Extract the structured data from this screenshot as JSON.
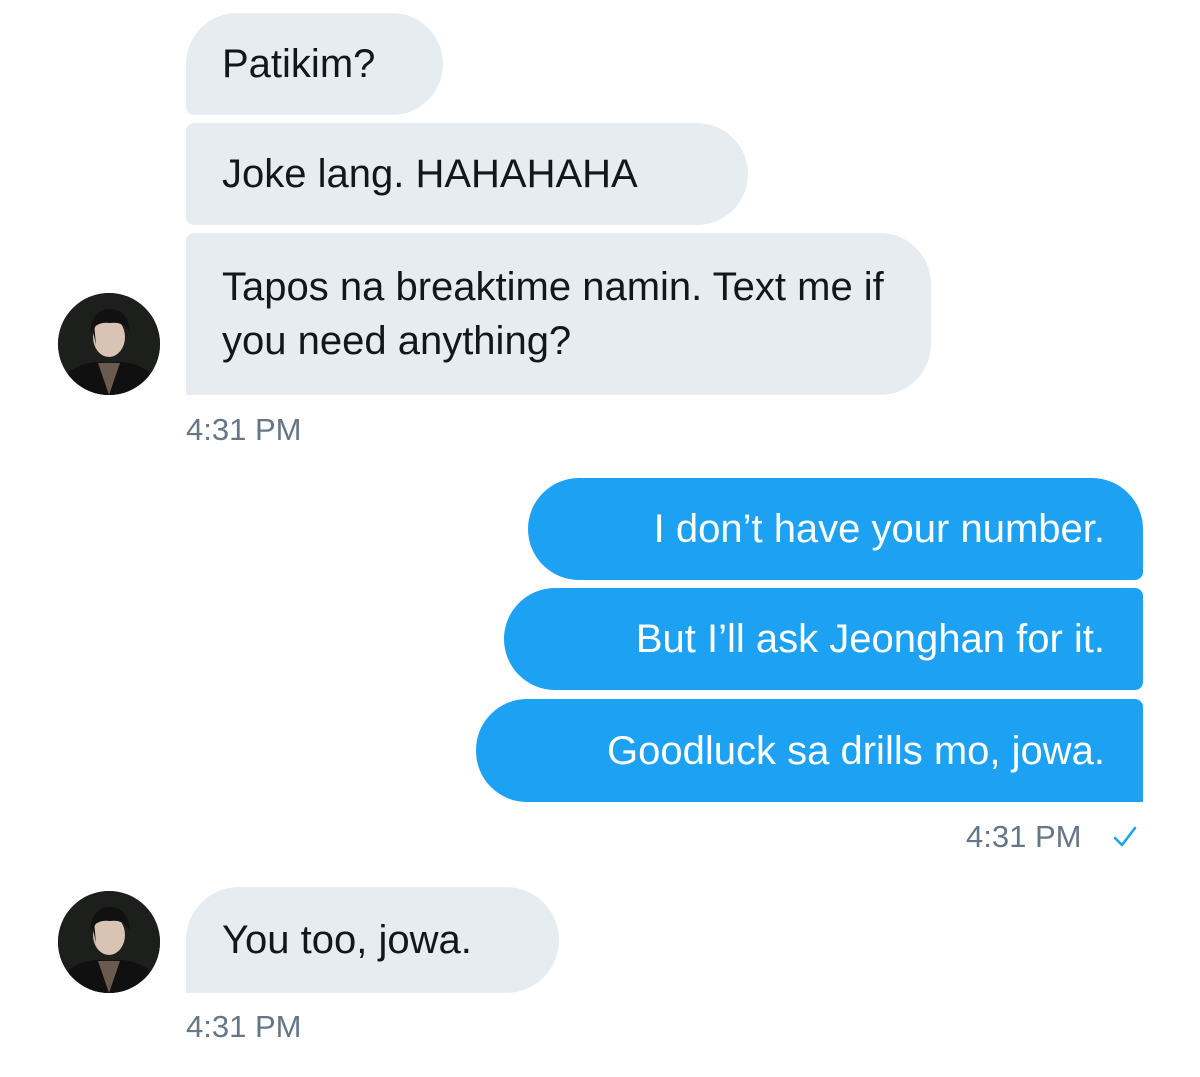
{
  "conversation": {
    "messages": [
      {
        "sender": "them",
        "text": "Patikim?"
      },
      {
        "sender": "them",
        "text": "Joke lang. HAHAHAHA"
      },
      {
        "sender": "them",
        "text": "Tapos na breaktime namin. Text me if you need anything?"
      },
      {
        "sender": "me",
        "text": "I don’t have your number."
      },
      {
        "sender": "me",
        "text": "But I’ll ask Jeonghan for it."
      },
      {
        "sender": "me",
        "text": "Goodluck sa drills mo, jowa."
      },
      {
        "sender": "them",
        "text": "You too, jowa."
      }
    ],
    "timestamps": [
      "4:31 PM",
      "4:31 PM",
      "4:31 PM"
    ],
    "read_receipt_icon": "checkmark-icon"
  },
  "colors": {
    "incoming_bubble": "#e6ecf0",
    "outgoing_bubble": "#1da1f2",
    "timestamp": "#657786"
  }
}
